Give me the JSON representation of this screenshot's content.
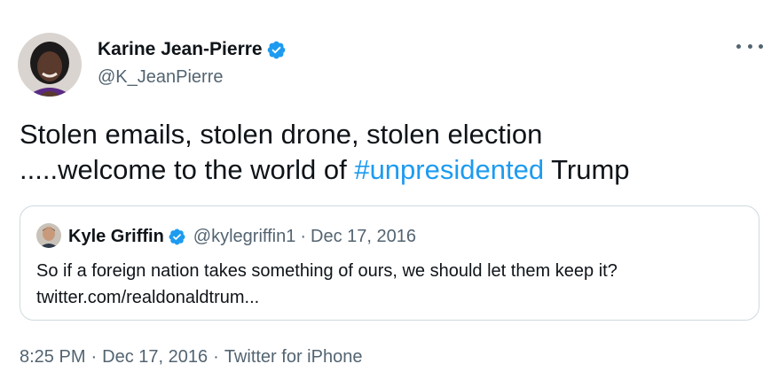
{
  "author": {
    "name": "Karine Jean-Pierre",
    "handle": "@K_JeanPierre",
    "verified": true
  },
  "tweet": {
    "text_line1": "Stolen emails, stolen drone, stolen election",
    "text_line2_before": ".....welcome to the world of ",
    "hashtag": "#unpresidented",
    "text_line2_after": " Trump"
  },
  "quoted_tweet": {
    "name": "Kyle Griffin",
    "handle": "@kylegriffin1",
    "separator": "·",
    "date": "Dec 17, 2016",
    "text_line1": "So if a foreign nation takes something of ours, we should let them keep it?",
    "text_line2": "twitter.com/realdonaldtrum..."
  },
  "meta": {
    "time": "8:25 PM",
    "separator": "·",
    "date": "Dec 17, 2016",
    "source": "Twitter for iPhone"
  },
  "icons": {
    "verified": "verified-badge-icon",
    "more": "more-options-icon"
  },
  "colors": {
    "accent": "#1d9bf0",
    "text": "#0f1419",
    "secondary": "#536471",
    "border": "#cfd9de"
  }
}
